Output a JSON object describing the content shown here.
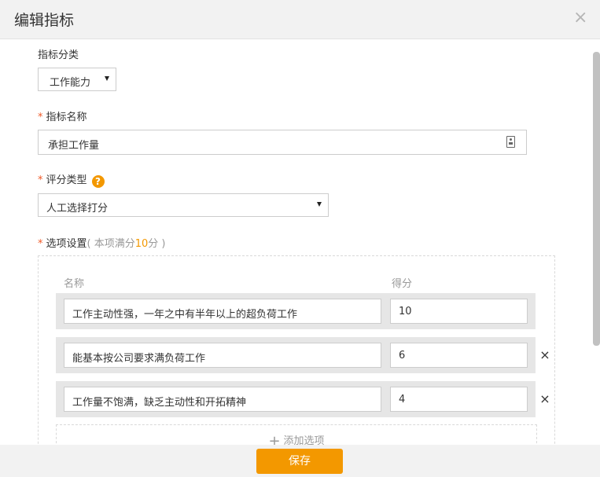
{
  "dialog": {
    "title": "编辑指标",
    "close_icon": "close-icon"
  },
  "category": {
    "label": "指标分类",
    "value": "工作能力"
  },
  "indicator_name": {
    "required_mark": "*",
    "label": "指标名称",
    "value": "承担工作量",
    "icon": "contact-card-icon"
  },
  "score_type": {
    "required_mark": "*",
    "label": "评分类型",
    "help_icon": "help-icon",
    "help_glyph": "?",
    "value": "人工选择打分"
  },
  "options": {
    "required_mark": "*",
    "label": "选项设置",
    "hint_prefix": "( 本项满分",
    "hint_value": "10",
    "hint_suffix": "分 )",
    "col_name": "名称",
    "col_score": "得分",
    "items": [
      {
        "name": "工作主动性强，一年之中有半年以上的超负荷工作",
        "score": "10"
      },
      {
        "name": "能基本按公司要求满负荷工作",
        "score": "6"
      },
      {
        "name": "工作量不饱满，缺乏主动性和开拓精神",
        "score": "4"
      }
    ],
    "remove_glyph": "×",
    "add_label": "添加选项",
    "add_glyph": "+"
  },
  "footer": {
    "save_label": "保存"
  },
  "colors": {
    "accent": "#f39800",
    "required": "#f05a28",
    "header_bg": "#f2f2f2"
  }
}
